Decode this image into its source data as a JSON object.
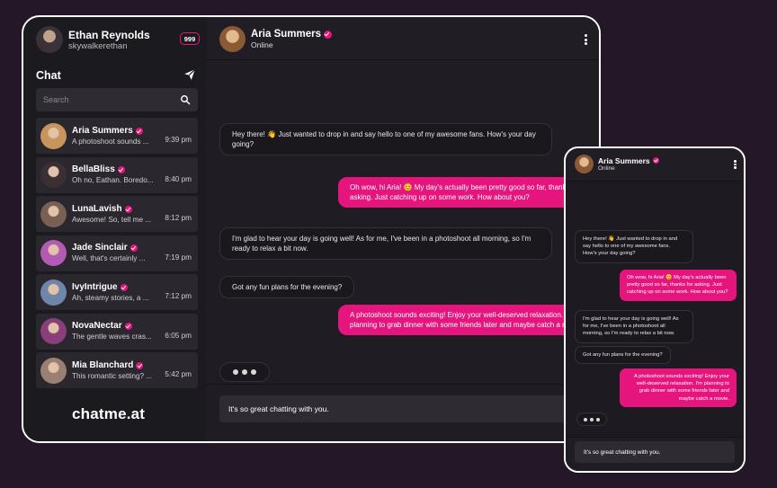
{
  "current_user": {
    "name": "Ethan Reynolds",
    "handle": "skywalkerethan",
    "notification_count": "999"
  },
  "sidebar": {
    "title": "Chat",
    "search_placeholder": "Search",
    "contacts": [
      {
        "name": "Aria Summers",
        "last_message": "A photoshoot sounds ...",
        "time": "9:39 pm",
        "avatar_color": "#c9955f"
      },
      {
        "name": "BellaBliss",
        "last_message": "Oh no, Eathan. Boredo...",
        "time": "8:40 pm",
        "avatar_color": "#3b2f34"
      },
      {
        "name": "LunaLavish",
        "last_message": "Awesome! So, tell me ...",
        "time": "8:12 pm",
        "avatar_color": "#7a5f55"
      },
      {
        "name": "Jade Sinclair",
        "last_message": "Well, that's certainly ...",
        "time": "7:19 pm",
        "avatar_color": "#b35ab3"
      },
      {
        "name": "IvyIntrigue",
        "last_message": "Ah, steamy stories, a ...",
        "time": "7:12 pm",
        "avatar_color": "#6f86a8"
      },
      {
        "name": "NovaNectar",
        "last_message": "The gentle waves cras...",
        "time": "6:05 pm",
        "avatar_color": "#8a3f7a"
      },
      {
        "name": "Mia Blanchard",
        "last_message": "This romantic setting? ...",
        "time": "5:42 pm",
        "avatar_color": "#9a7f72"
      }
    ]
  },
  "logo": "chatme.at",
  "conversation": {
    "peer_name": "Aria Summers",
    "peer_status": "Online",
    "messages": [
      {
        "direction": "in",
        "text": "Hey there! 👋 Just wanted to drop in and say hello to one of my awesome fans. How's your day going?"
      },
      {
        "direction": "out",
        "text": "Oh wow, hi Aria! 😊 My day's actually been pretty good so far, thanks for asking. Just catching up on some work. How about you?"
      },
      {
        "direction": "in",
        "text": "I'm glad to hear your day is going well! As for me, I've been in a photoshoot all morning, so I'm ready to relax a bit now."
      },
      {
        "direction": "in",
        "text": "Got any fun plans for the evening?"
      },
      {
        "direction": "out",
        "text": "A photoshoot sounds exciting! Enjoy your well-deserved relaxation. I'm planning to grab dinner with some friends later and maybe catch a movie."
      }
    ],
    "composer_value": "It's so great chatting with you."
  },
  "colors": {
    "accent": "#e6157d",
    "background": "#241728",
    "panel": "#1f1c24"
  },
  "icons": {
    "send": "send-icon",
    "search": "search-icon",
    "menu": "kebab-menu-icon",
    "verified": "verified-icon"
  }
}
